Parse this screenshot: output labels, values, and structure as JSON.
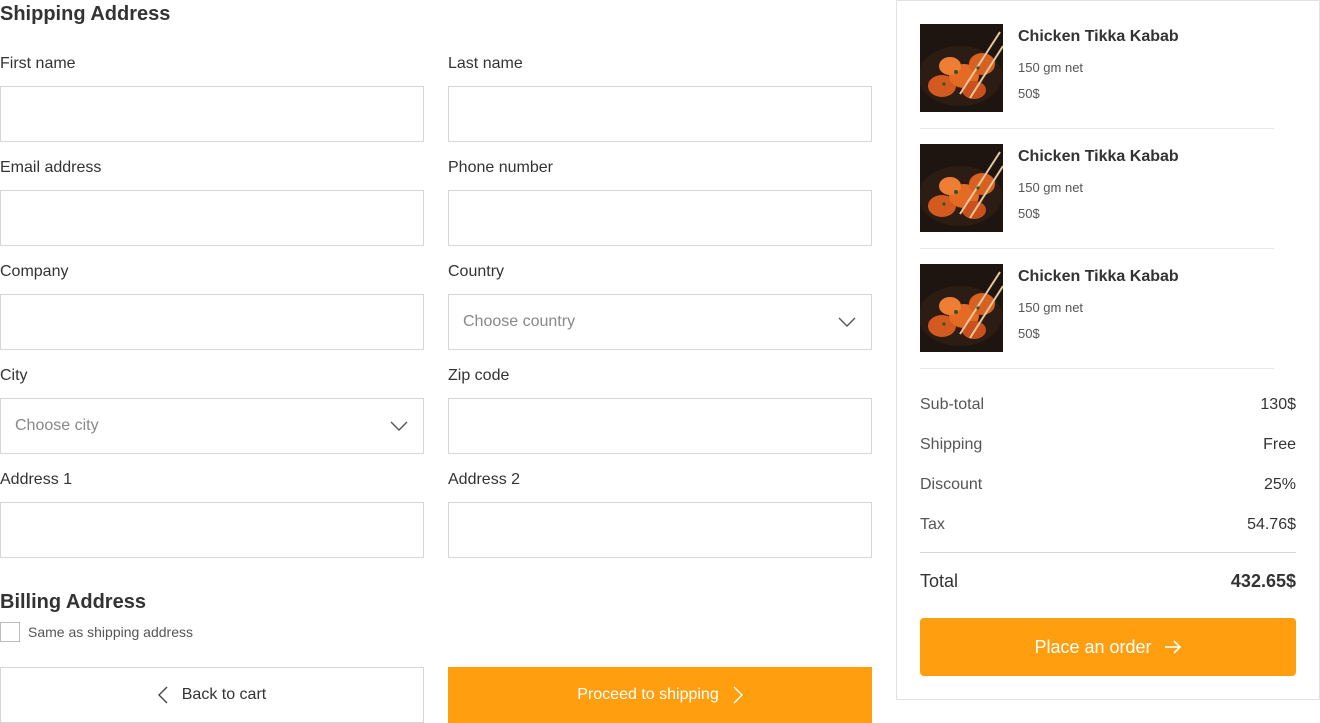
{
  "shipping": {
    "title": "Shipping Address",
    "fields": {
      "first_name": {
        "label": "First name",
        "value": ""
      },
      "last_name": {
        "label": "Last name",
        "value": ""
      },
      "email": {
        "label": "Email address",
        "value": ""
      },
      "phone": {
        "label": "Phone number",
        "value": ""
      },
      "company": {
        "label": "Company",
        "value": ""
      },
      "country": {
        "label": "Country",
        "selected": "Choose country"
      },
      "city": {
        "label": "City",
        "selected": "Choose city"
      },
      "zip": {
        "label": "Zip code",
        "value": ""
      },
      "address1": {
        "label": "Address 1",
        "value": ""
      },
      "address2": {
        "label": "Address 2",
        "value": ""
      }
    }
  },
  "billing": {
    "title": "Billing Address",
    "same_as_shipping_label": "Same as shipping address",
    "same_as_shipping_checked": false
  },
  "actions": {
    "back_label": "Back to cart",
    "proceed_label": "Proceed to shipping"
  },
  "cart": {
    "items": [
      {
        "name": "Chicken Tikka Kabab",
        "weight": "150 gm net",
        "price": "50$"
      },
      {
        "name": "Chicken Tikka Kabab",
        "weight": "150 gm net",
        "price": "50$"
      },
      {
        "name": "Chicken Tikka Kabab",
        "weight": "150 gm net",
        "price": "50$"
      }
    ],
    "summary": {
      "subtotal_label": "Sub-total",
      "subtotal_value": "130$",
      "shipping_label": "Shipping",
      "shipping_value": "Free",
      "discount_label": "Discount",
      "discount_value": "25%",
      "tax_label": "Tax",
      "tax_value": "54.76$",
      "total_label": "Total",
      "total_value": "432.65$"
    },
    "order_label": "Place an order"
  },
  "colors": {
    "accent": "#ff9f0f",
    "border": "#d6d6d6",
    "text": "#333333",
    "placeholder": "#888888"
  }
}
